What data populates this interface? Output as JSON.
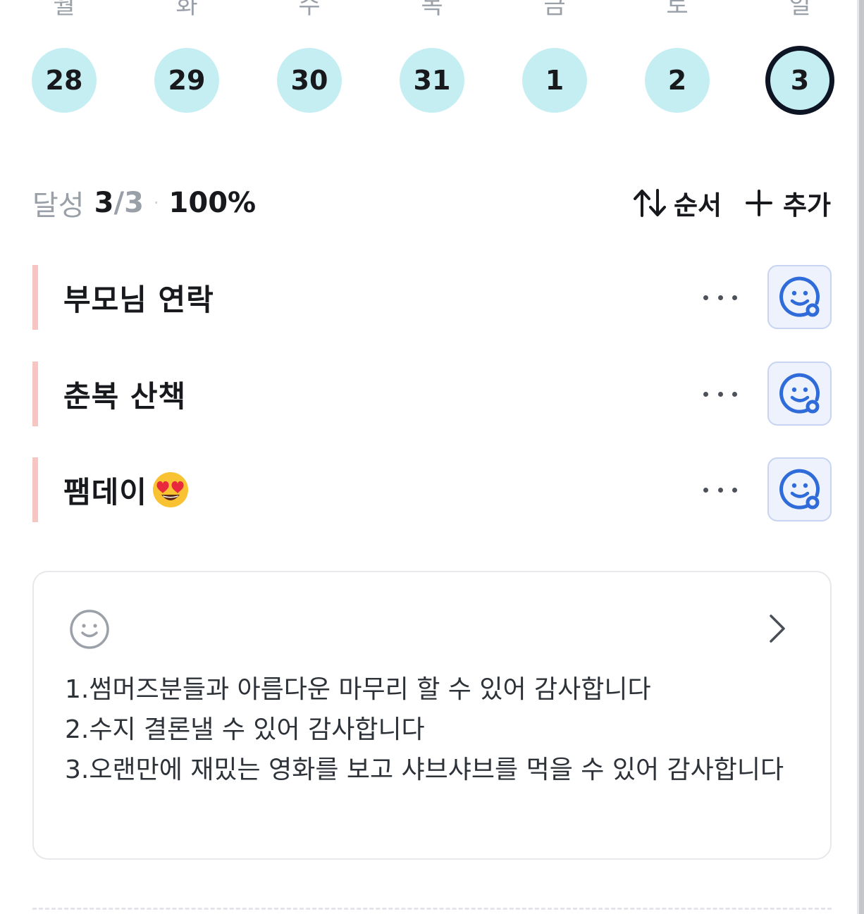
{
  "week": {
    "days": [
      {
        "label": "월",
        "date": "28"
      },
      {
        "label": "화",
        "date": "29"
      },
      {
        "label": "수",
        "date": "30"
      },
      {
        "label": "목",
        "date": "31"
      },
      {
        "label": "금",
        "date": "1"
      },
      {
        "label": "토",
        "date": "2"
      },
      {
        "label": "일",
        "date": "3"
      }
    ],
    "selected_date": "3"
  },
  "summary": {
    "label": "달성",
    "done": "3",
    "total": "/3",
    "separator": "·",
    "percent": "100%"
  },
  "toolbar": {
    "sort_label": "순서",
    "add_label": "추가"
  },
  "habits": [
    {
      "title": "부모님 연락",
      "emoji": ""
    },
    {
      "title": "춘복 산책",
      "emoji": ""
    },
    {
      "title": "팸데이",
      "emoji": "heart-eyes-emoji"
    }
  ],
  "gratitude": {
    "lines": [
      "1.썸머즈분들과 아름다운 마무리 할 수 있어 감사합니다",
      "2.수지 결론낼 수 있어 감사합니다",
      "3.오랜만에 재밌는 영화를 보고 샤브샤브를 먹을 수 있어 감사합니다"
    ]
  },
  "colors": {
    "day_circle": "#c5eef3",
    "selected_ring": "#0d1424",
    "habit_bar": "#f7c6c2",
    "check_bg": "#eef2fc",
    "check_icon": "#2f6bd9"
  }
}
